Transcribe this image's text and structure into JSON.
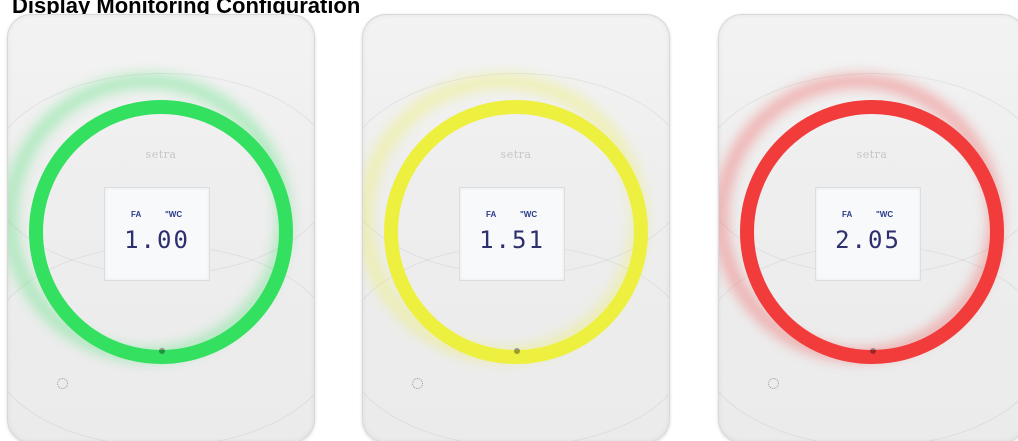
{
  "heading": "Display Monitoring Configuration",
  "devices": [
    {
      "brand": "setra",
      "unit_left": "FA",
      "unit_right": "\"WC",
      "reading": "1.00",
      "ring_color": "#33e060",
      "state": "green"
    },
    {
      "brand": "setra",
      "unit_left": "FA",
      "unit_right": "\"WC",
      "reading": "1.51",
      "ring_color": "#eef040",
      "state": "yellow"
    },
    {
      "brand": "setra",
      "unit_left": "FA",
      "unit_right": "\"WC",
      "reading": "2.05",
      "ring_color": "#f23c3c",
      "state": "red"
    }
  ]
}
